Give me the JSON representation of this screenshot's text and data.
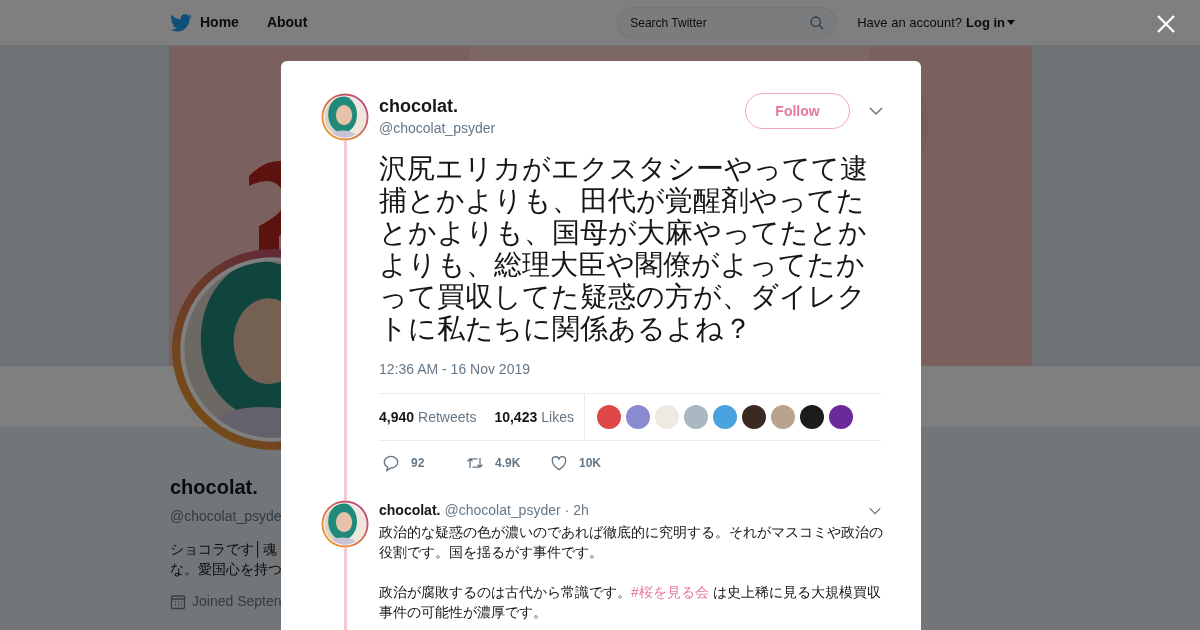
{
  "header": {
    "nav": [
      {
        "label": "Home"
      },
      {
        "label": "About"
      }
    ],
    "search": {
      "placeholder": "Search Twitter"
    },
    "account_prompt": "Have an account?",
    "login": "Log in"
  },
  "profile": {
    "name": "chocolat.",
    "handle": "@chocolat_psyde",
    "bio_lines": [
      "ショコラです│魂",
      "な。愛国心を持つ"
    ],
    "joined": "Joined Septen"
  },
  "tweet": {
    "name": "chocolat.",
    "handle": "@chocolat_psyder",
    "follow": "Follow",
    "text": "沢尻エリカがエクスタシーやってて逮捕とかよりも、田代が覚醒剤やってたとかよりも、国母が大麻やってたとかよりも、総理大臣や閣僚がよってたかって買収してた疑惑の方が、ダイレクトに私たちに関係あるよね？",
    "timestamp": "12:36 AM - 16 Nov 2019",
    "stats": [
      {
        "count": "4,940",
        "label": "Retweets"
      },
      {
        "count": "10,423",
        "label": "Likes"
      }
    ],
    "likers": [
      {
        "color": "#e04848"
      },
      {
        "color": "#8a8ad0"
      },
      {
        "color": "#efe9e4"
      },
      {
        "color": "#aab8c2"
      },
      {
        "color": "#4aa3df"
      },
      {
        "color": "#3a2a22"
      },
      {
        "color": "#b8a48e"
      },
      {
        "color": "#1c1c1c"
      },
      {
        "color": "#6b2a9a"
      }
    ],
    "actions": [
      {
        "kind": "reply",
        "count": "92"
      },
      {
        "kind": "retweet",
        "count": "4.9K"
      },
      {
        "kind": "like",
        "count": "10K"
      }
    ]
  },
  "reply": {
    "name": "chocolat.",
    "handle": "@chocolat_psyder",
    "time": "· 2h",
    "paragraphs": [
      [
        {
          "text": "政治的な疑惑の色が濃いのであれば徹底的に究明する。それがマスコミや政治の役割です。国を揺るがす事件です。"
        }
      ],
      [
        {
          "text": "政治が腐敗するのは古代から常識です。"
        },
        {
          "text": "#桜を見る会",
          "kind": "hashtag"
        },
        {
          "text": " は史上稀に見る大規模買収事件の可能性が濃厚です。"
        }
      ]
    ]
  }
}
